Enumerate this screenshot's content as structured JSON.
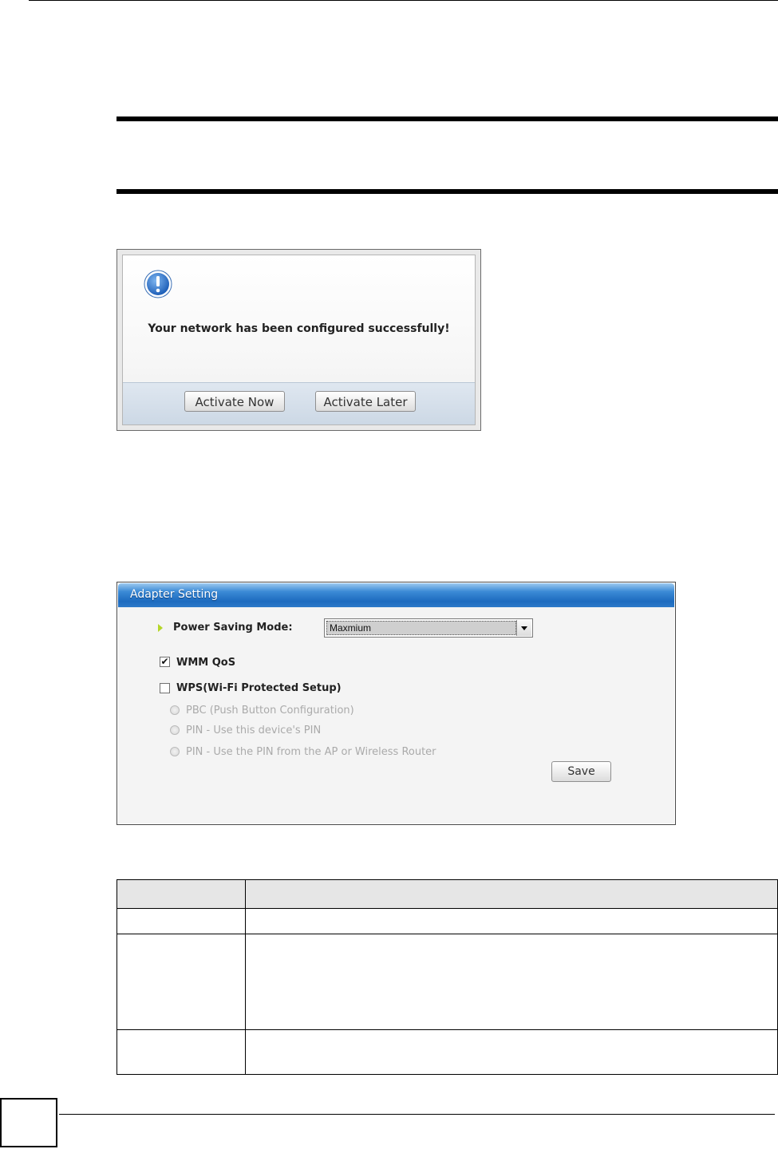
{
  "dialog": {
    "message": "Your network has been configured successfully!",
    "buttons": {
      "activate_now": "Activate Now",
      "activate_later": "Activate Later"
    }
  },
  "adapter_setting": {
    "title": "Adapter Setting",
    "power_saving_label": "Power Saving Mode:",
    "power_saving_value": "Maxmium",
    "wmm_qos_label": "WMM QoS",
    "wmm_qos_checked": true,
    "wps_label": "WPS(Wi-Fi Protected Setup)",
    "wps_checked": false,
    "wps_options": [
      "PBC (Push Button Configuration)",
      "PIN - Use this device's PIN",
      "PIN - Use the PIN from the AP or Wireless Router"
    ],
    "save_label": "Save",
    "checkmark": "✔"
  },
  "colors": {
    "header_blue": "#1d6bbf",
    "bullet_green": "#b5d629"
  }
}
